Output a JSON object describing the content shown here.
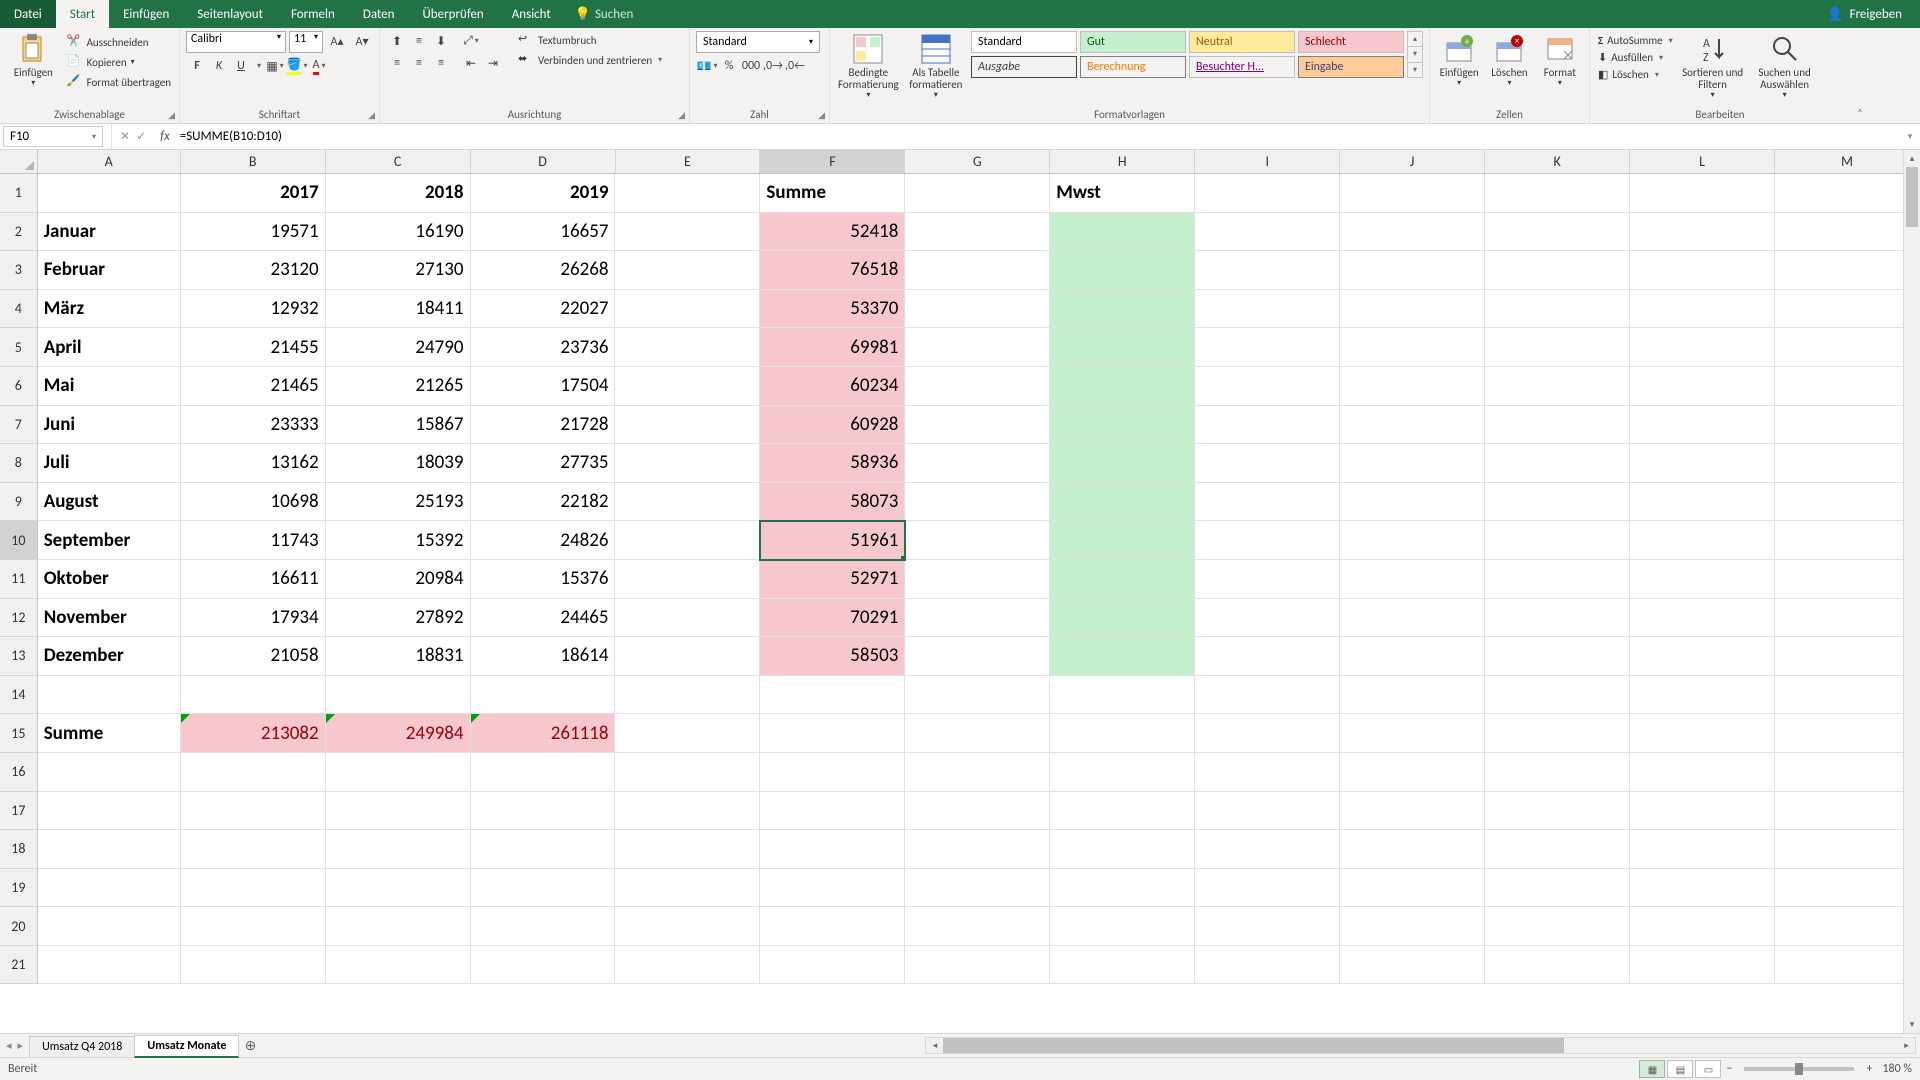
{
  "menu": {
    "datei": "Datei",
    "start": "Start",
    "einfuegen": "Einfügen",
    "seitenlayout": "Seitenlayout",
    "formeln": "Formeln",
    "daten": "Daten",
    "ueberpruefen": "Überprüfen",
    "ansicht": "Ansicht",
    "search": "Suchen",
    "share": "Freigeben"
  },
  "ribbon": {
    "paste": "Einfügen",
    "cut": "Ausschneiden",
    "copy": "Kopieren",
    "formatpainter": "Format übertragen",
    "clipboard": "Zwischenablage",
    "font_group": "Schriftart",
    "font": "Calibri",
    "size": "11",
    "align_group": "Ausrichtung",
    "wrap": "Textumbruch",
    "merge": "Verbinden und zentrieren",
    "number_group": "Zahl",
    "numfmt": "Standard",
    "condfmt": "Bedingte Formatierung",
    "astable": "Als Tabelle formatieren",
    "styles_group": "Formatvorlagen",
    "style_standard": "Standard",
    "style_gut": "Gut",
    "style_neutral": "Neutral",
    "style_schlecht": "Schlecht",
    "style_ausgabe": "Ausgabe",
    "style_berechnung": "Berechnung",
    "style_besuchter": "Besuchter H...",
    "style_eingabe": "Eingabe",
    "cells_group": "Zellen",
    "insert": "Einfügen",
    "delete": "Löschen",
    "format": "Format",
    "edit_group": "Bearbeiten",
    "autosum": "AutoSumme",
    "fill": "Ausfüllen",
    "clear": "Löschen",
    "sort": "Sortieren und Filtern",
    "find": "Suchen und Auswählen"
  },
  "namebox": "F10",
  "formula": "=SUMME(B10:D10)",
  "cols": [
    "A",
    "B",
    "C",
    "D",
    "E",
    "F",
    "G",
    "H",
    "I",
    "J",
    "K",
    "L",
    "M"
  ],
  "headers": {
    "b": "2017",
    "c": "2018",
    "d": "2019",
    "f": "Summe",
    "h": "Mwst"
  },
  "rows": [
    {
      "a": "Januar",
      "b": "19571",
      "c": "16190",
      "d": "16657",
      "f": "52418"
    },
    {
      "a": "Februar",
      "b": "23120",
      "c": "27130",
      "d": "26268",
      "f": "76518"
    },
    {
      "a": "März",
      "b": "12932",
      "c": "18411",
      "d": "22027",
      "f": "53370"
    },
    {
      "a": "April",
      "b": "21455",
      "c": "24790",
      "d": "23736",
      "f": "69981"
    },
    {
      "a": "Mai",
      "b": "21465",
      "c": "21265",
      "d": "17504",
      "f": "60234"
    },
    {
      "a": "Juni",
      "b": "23333",
      "c": "15867",
      "d": "21728",
      "f": "60928"
    },
    {
      "a": "Juli",
      "b": "13162",
      "c": "18039",
      "d": "27735",
      "f": "58936"
    },
    {
      "a": "August",
      "b": "10698",
      "c": "25193",
      "d": "22182",
      "f": "58073"
    },
    {
      "a": "September",
      "b": "11743",
      "c": "15392",
      "d": "24826",
      "f": "51961"
    },
    {
      "a": "Oktober",
      "b": "16611",
      "c": "20984",
      "d": "15376",
      "f": "52971"
    },
    {
      "a": "November",
      "b": "17934",
      "c": "27892",
      "d": "24465",
      "f": "70291"
    },
    {
      "a": "Dezember",
      "b": "21058",
      "c": "18831",
      "d": "18614",
      "f": "58503"
    }
  ],
  "sumrow": {
    "a": "Summe",
    "b": "213082",
    "c": "249984",
    "d": "261118"
  },
  "sheets": {
    "s1": "Umsatz Q4 2018",
    "s2": "Umsatz Monate"
  },
  "status": {
    "ready": "Bereit",
    "zoom": "180 %"
  }
}
